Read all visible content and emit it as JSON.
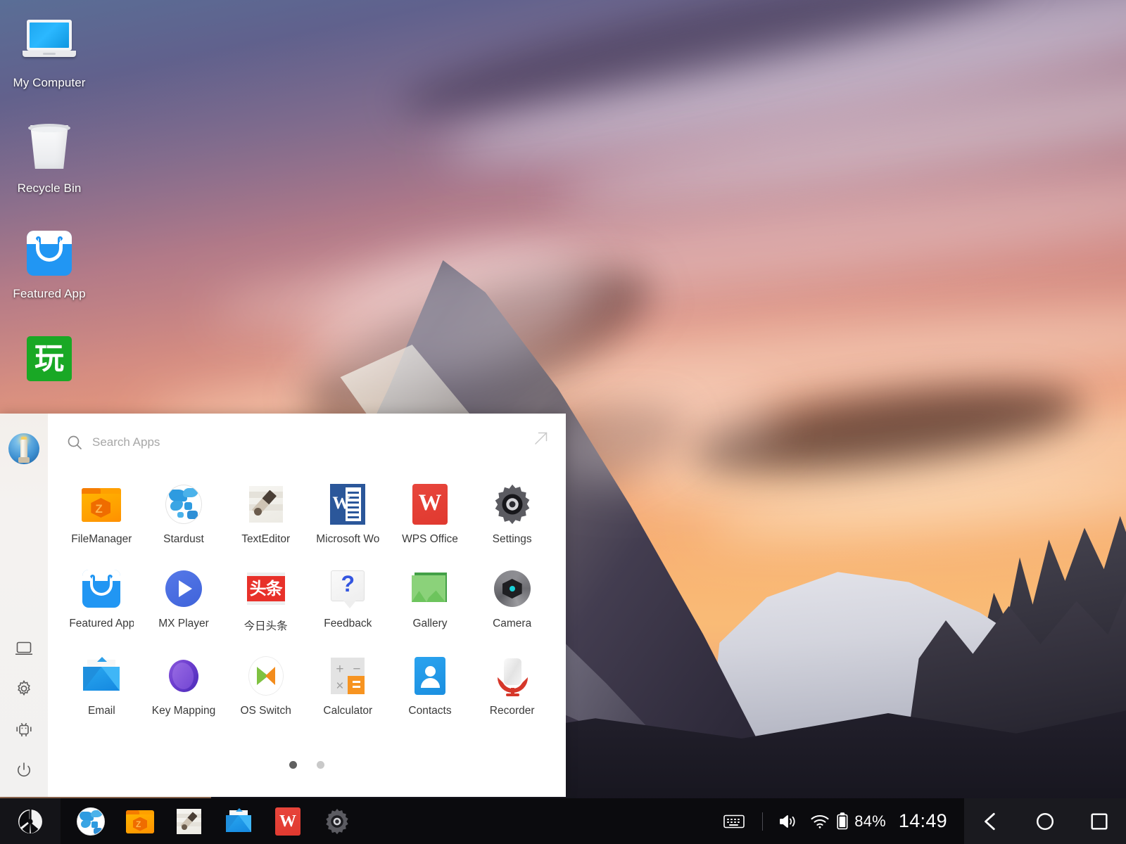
{
  "desktop": {
    "icons": [
      {
        "label": "My Computer",
        "icon": "computer-icon"
      },
      {
        "label": "Recycle Bin",
        "icon": "recycle-bin-icon"
      },
      {
        "label": "Featured App",
        "icon": "featured-app-icon"
      },
      {
        "label": "玩",
        "icon": "green-app-icon"
      }
    ]
  },
  "launcher": {
    "search": {
      "placeholder": "Search Apps",
      "value": ""
    },
    "expand_label": "Expand",
    "apps": [
      {
        "name": "FileManager",
        "icon": "filemanager-icon"
      },
      {
        "name": "Stardust",
        "icon": "stardust-browser-icon"
      },
      {
        "name": "TextEditor",
        "icon": "texteditor-icon"
      },
      {
        "name": "Microsoft Wo",
        "icon": "microsoft-word-icon"
      },
      {
        "name": "WPS Office",
        "icon": "wps-office-icon"
      },
      {
        "name": "Settings",
        "icon": "settings-gear-icon"
      },
      {
        "name": "Featured App",
        "icon": "featured-app-icon"
      },
      {
        "name": "MX Player",
        "icon": "mx-player-icon"
      },
      {
        "name": "今日头条",
        "icon": "toutiao-icon",
        "cjk": true
      },
      {
        "name": "Feedback",
        "icon": "feedback-icon"
      },
      {
        "name": "Gallery",
        "icon": "gallery-icon"
      },
      {
        "name": "Camera",
        "icon": "camera-icon"
      },
      {
        "name": "Email",
        "icon": "email-icon"
      },
      {
        "name": "Key Mapping",
        "icon": "key-mapping-icon"
      },
      {
        "name": "OS Switch",
        "icon": "os-switch-icon"
      },
      {
        "name": "Calculator",
        "icon": "calculator-icon"
      },
      {
        "name": "Contacts",
        "icon": "contacts-icon"
      },
      {
        "name": "Recorder",
        "icon": "recorder-icon"
      }
    ],
    "pages": {
      "count": 2,
      "current": 1
    },
    "sidebar": {
      "avatar_label": "User avatar",
      "tools": [
        {
          "name": "display-icon",
          "label": "Display"
        },
        {
          "name": "settings-icon",
          "label": "Settings"
        },
        {
          "name": "android-icon",
          "label": "Android"
        },
        {
          "name": "power-icon",
          "label": "Power"
        }
      ]
    }
  },
  "taskbar": {
    "start_label": "Start",
    "apps": [
      {
        "name": "stardust-browser-icon",
        "label": "Stardust"
      },
      {
        "name": "filemanager-icon",
        "label": "FileManager"
      },
      {
        "name": "texteditor-icon",
        "label": "TextEditor"
      },
      {
        "name": "email-icon",
        "label": "Email"
      },
      {
        "name": "wps-office-icon",
        "label": "WPS Office"
      },
      {
        "name": "settings-gear-icon",
        "label": "Settings"
      }
    ],
    "tray": {
      "keyboard_label": "Keyboard",
      "volume_label": "Volume",
      "wifi_label": "Wi-Fi",
      "battery_label": "Battery",
      "battery_percent": "84%",
      "clock": "14:49"
    },
    "nav": [
      {
        "name": "back-icon",
        "label": "Back"
      },
      {
        "name": "home-icon",
        "label": "Home"
      },
      {
        "name": "recents-icon",
        "label": "Recents"
      }
    ]
  },
  "colors": {
    "accent_blue": "#2196f3",
    "word_blue": "#2b579a",
    "wps_red": "#e0392f",
    "taskbar_bg": "#0b0b0e",
    "panel_bg": "#ffffff"
  }
}
